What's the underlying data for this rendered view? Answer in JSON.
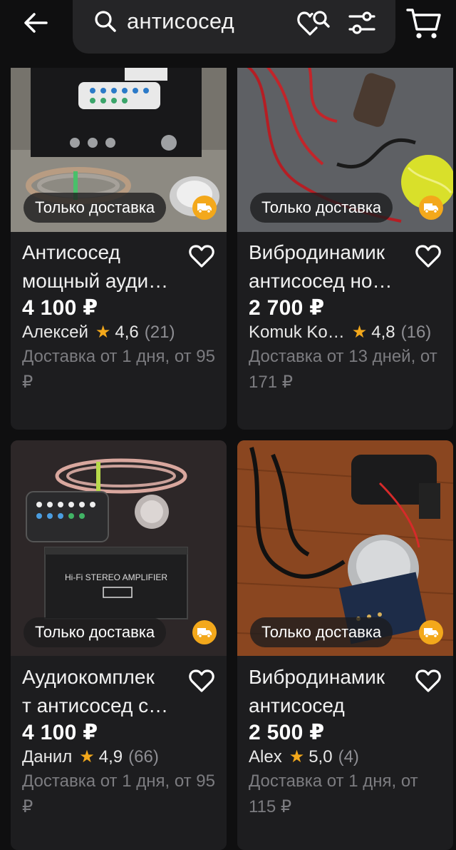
{
  "search": {
    "query": "антисосед"
  },
  "colors": {
    "background": "#0f0f10",
    "card": "#1d1d1f",
    "accent": "#f3a81b",
    "muted_text": "#7c7c80"
  },
  "icons": {
    "back": "arrow-left-icon",
    "search": "search-icon",
    "saved_search": "heart-search-icon",
    "filters": "sliders-icon",
    "cart": "cart-icon",
    "favorite": "heart-icon",
    "delivery": "truck-icon",
    "rating": "star-icon"
  },
  "products": [
    {
      "badge": "Только доставка",
      "title": "Антисосед\nмощный ауди…",
      "price": "4 100 ₽",
      "seller": "Алексей",
      "rating": "4,6",
      "reviews": "(21)",
      "delivery": "Доставка от 1 дня, от 95 ₽"
    },
    {
      "badge": "Только доставка",
      "title": "Вибродинамик\nантисосед но…",
      "price": "2 700 ₽",
      "seller": "Komuk Ko…",
      "rating": "4,8",
      "reviews": "(16)",
      "delivery": "Доставка от 13 дней, от 171 ₽"
    },
    {
      "badge": "Только доставка",
      "title": "Аудиокомплек\nт антисосед с…",
      "price": "4 100 ₽",
      "seller": "Данил",
      "rating": "4,9",
      "reviews": "(66)",
      "delivery": "Доставка от 1 дня, от 95 ₽"
    },
    {
      "badge": "Только доставка",
      "title": "Вибродинамик\nантисосед",
      "price": "2 500 ₽",
      "seller": "Alex",
      "rating": "5,0",
      "reviews": "(4)",
      "delivery": "Доставка от 1 дня, от 115 ₽"
    }
  ]
}
